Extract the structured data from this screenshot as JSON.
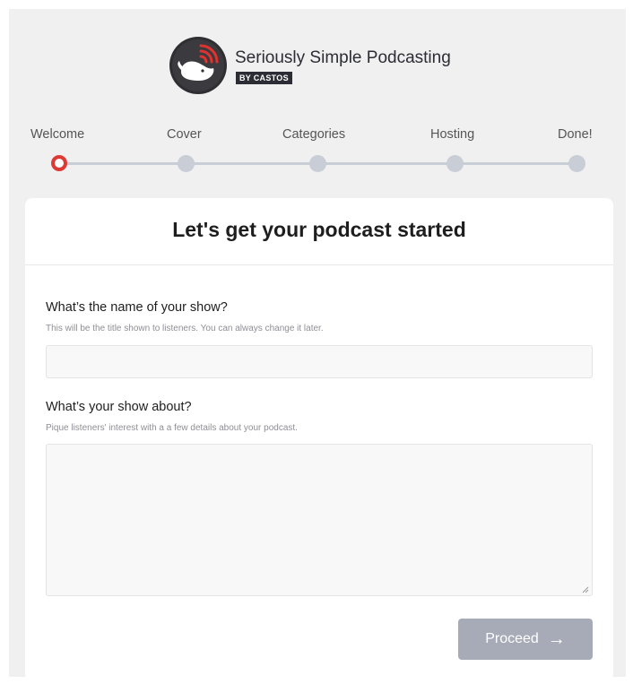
{
  "header": {
    "title": "Seriously Simple Podcasting",
    "badge": "BY CASTOS"
  },
  "steps": [
    {
      "label": "Welcome",
      "active": true
    },
    {
      "label": "Cover",
      "active": false
    },
    {
      "label": "Categories",
      "active": false
    },
    {
      "label": "Hosting",
      "active": false
    },
    {
      "label": "Done!",
      "active": false
    }
  ],
  "card": {
    "title": "Let's get your podcast started",
    "show_name": {
      "label": "What’s the name of your show?",
      "help": "This will be the title shown to listeners. You can always change it later.",
      "value": "",
      "placeholder": ""
    },
    "show_about": {
      "label": "What’s your show about?",
      "help": "Pique listeners' interest with a a few details about your podcast.",
      "value": "",
      "placeholder": ""
    },
    "proceed_label": "Proceed",
    "proceed_icon": "arrow-right-icon"
  },
  "colors": {
    "accent_red": "#dd3a36",
    "dark": "#2c2c34",
    "disabled_button": "#a7abb7",
    "step_inactive": "#c9cdd6"
  }
}
